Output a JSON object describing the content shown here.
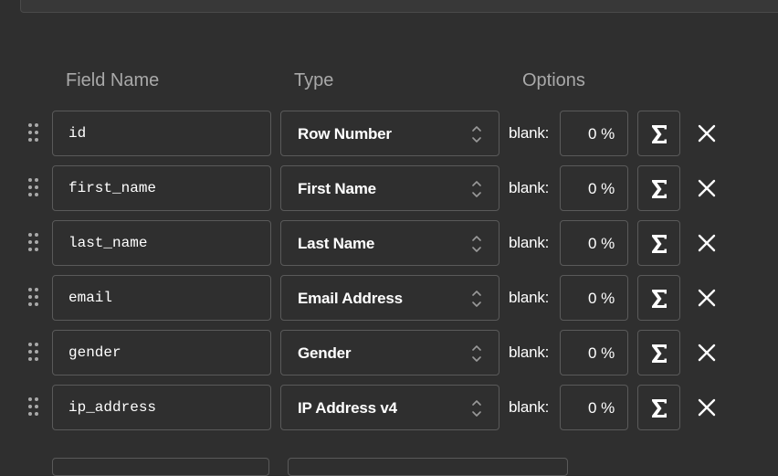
{
  "headers": {
    "field_name": "Field Name",
    "type": "Type",
    "options": "Options"
  },
  "rows": [
    {
      "name": "id",
      "type": "Row Number",
      "blank_label": "blank:",
      "blank_value": "0 %"
    },
    {
      "name": "first_name",
      "type": "First Name",
      "blank_label": "blank:",
      "blank_value": "0 %"
    },
    {
      "name": "last_name",
      "type": "Last Name",
      "blank_label": "blank:",
      "blank_value": "0 %"
    },
    {
      "name": "email",
      "type": "Email Address",
      "blank_label": "blank:",
      "blank_value": "0 %"
    },
    {
      "name": "gender",
      "type": "Gender",
      "blank_label": "blank:",
      "blank_value": "0 %"
    },
    {
      "name": "ip_address",
      "type": "IP Address v4",
      "blank_label": "blank:",
      "blank_value": "0 %"
    }
  ],
  "icons": {
    "drag": "drag-handle-icon",
    "updown": "chevron-updown-icon",
    "formula": "sigma-icon",
    "remove": "close-icon"
  },
  "colors": {
    "background": "#2f2f2f",
    "border": "#5a5a5a",
    "header_text": "#a9a9a9",
    "text": "#ffffff"
  }
}
